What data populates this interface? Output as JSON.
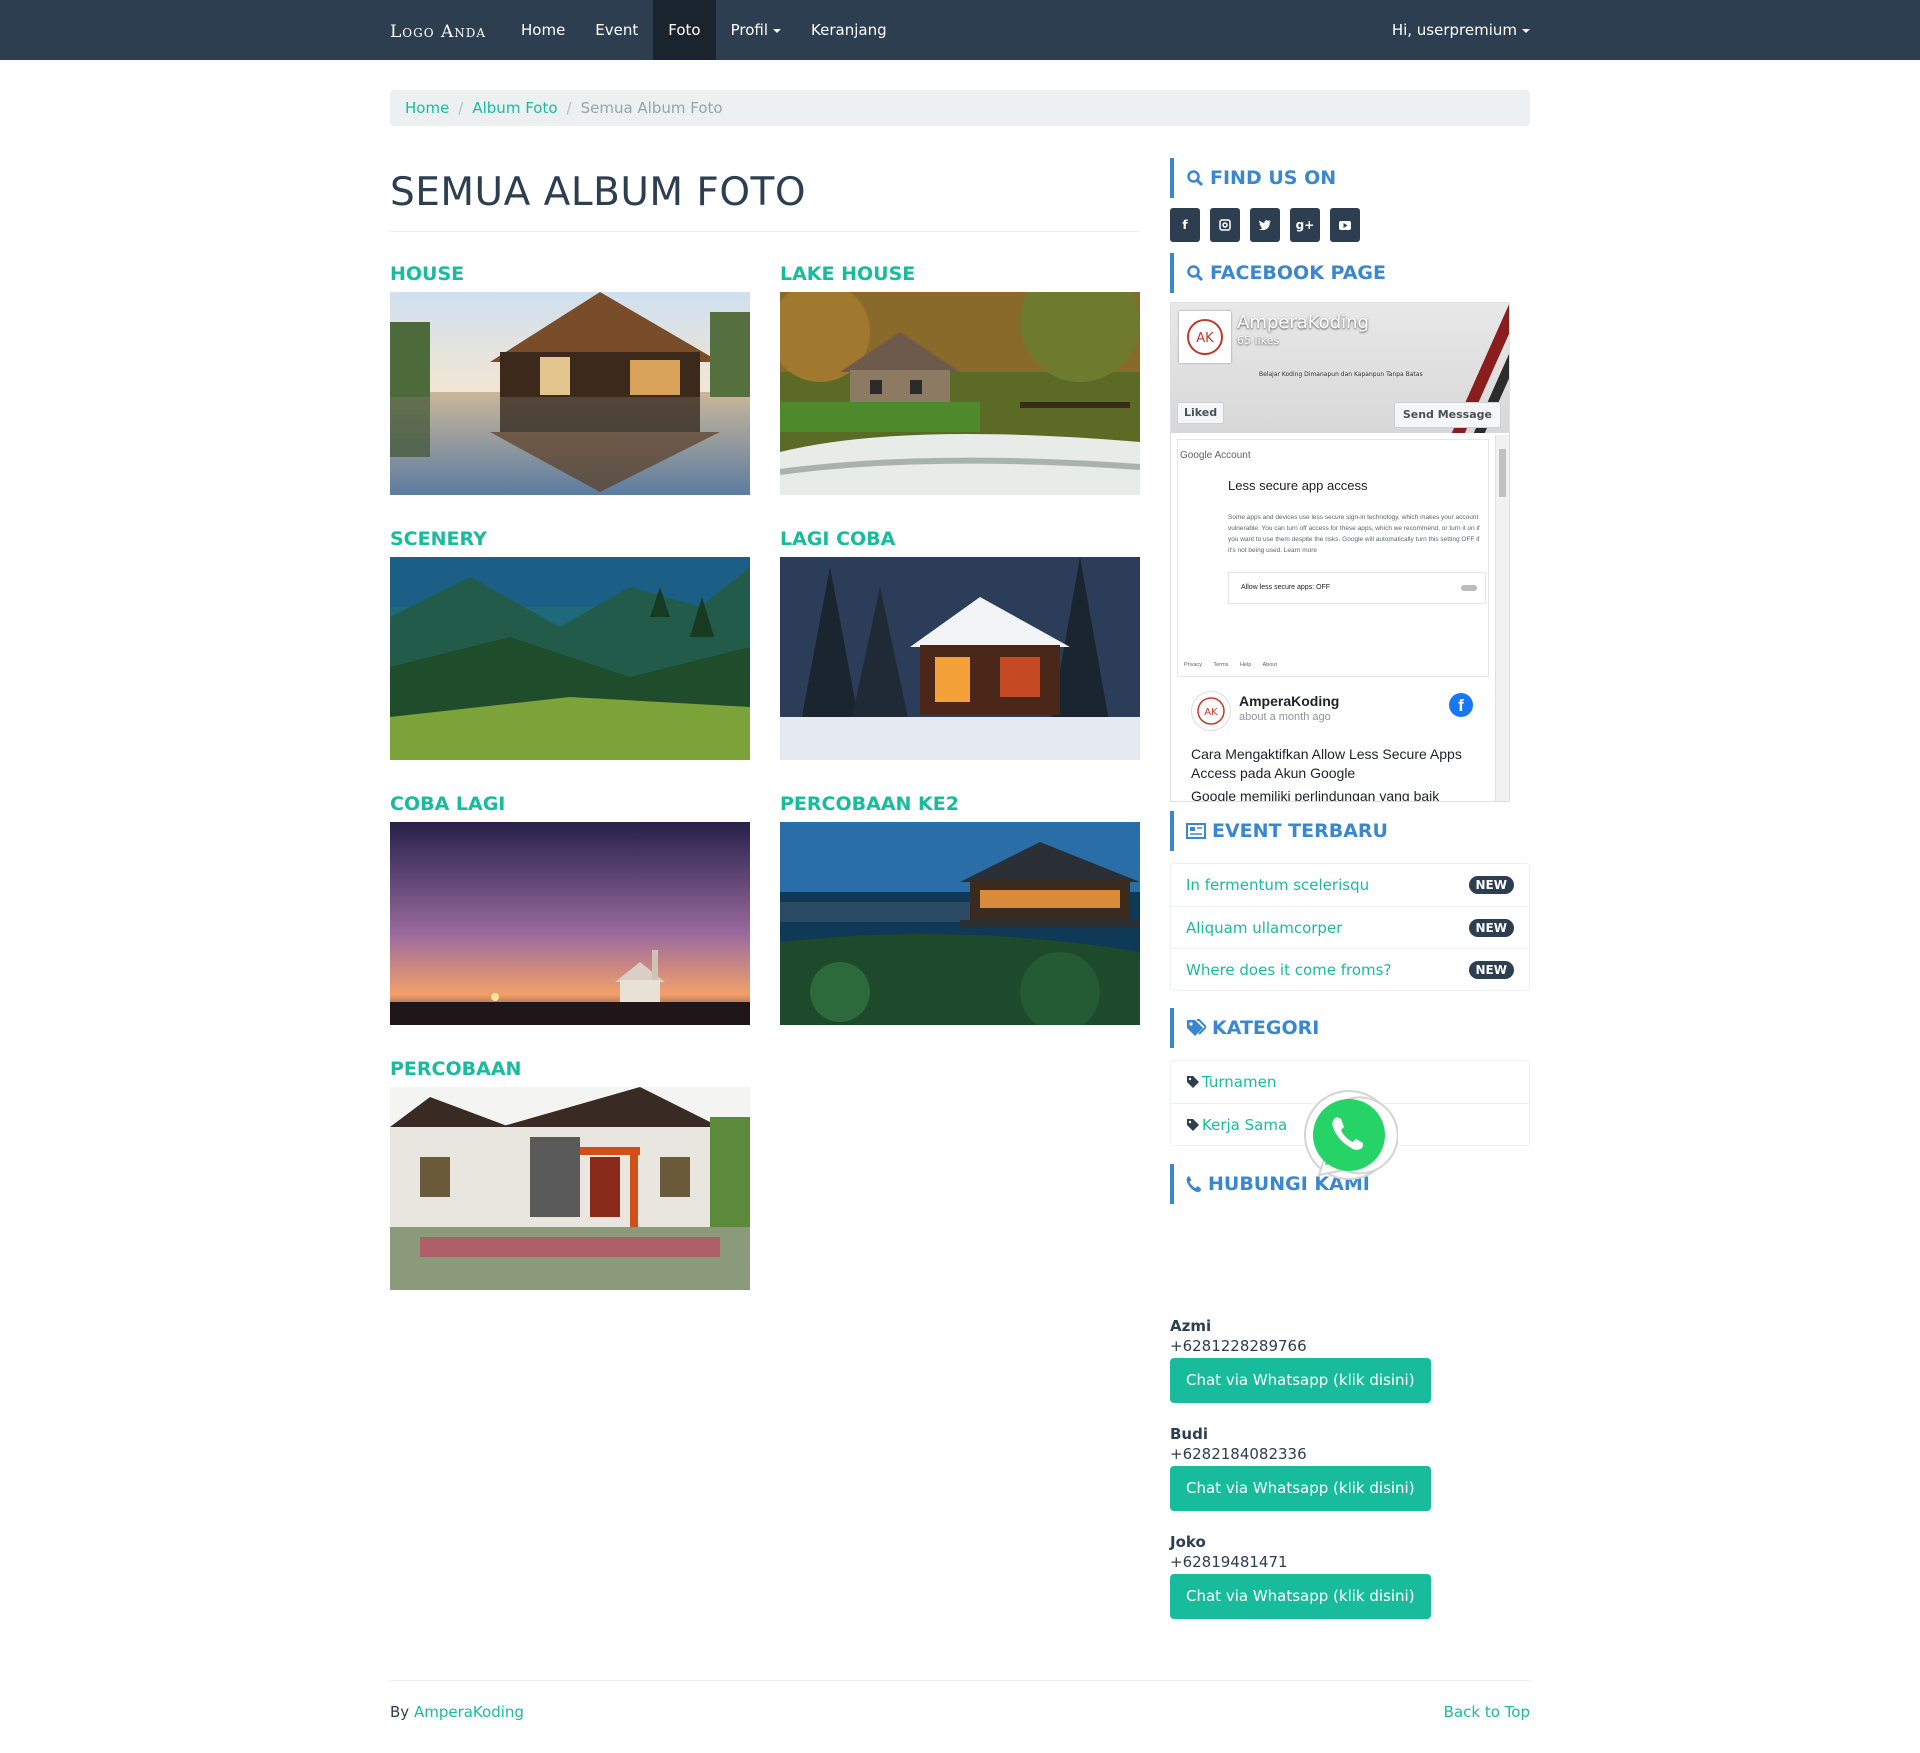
{
  "navbar": {
    "brand": "Logo Anda",
    "links": [
      {
        "label": "Home",
        "active": false
      },
      {
        "label": "Event",
        "active": false
      },
      {
        "label": "Foto",
        "active": true
      },
      {
        "label": "Profil",
        "active": false,
        "dropdown": true
      },
      {
        "label": "Keranjang",
        "active": false
      }
    ],
    "user_menu": "Hi, userpremium"
  },
  "breadcrumb": {
    "items": [
      "Home",
      "Album Foto"
    ],
    "current": "Semua Album Foto"
  },
  "main": {
    "title": "SEMUA ALBUM FOTO",
    "albums": [
      {
        "name": "HOUSE",
        "image": "modern house reflected in pool"
      },
      {
        "name": "LAKE HOUSE",
        "image": "stone cottage by river in forest"
      },
      {
        "name": "SCENERY",
        "image": "green mountain valley"
      },
      {
        "name": "LAGI COBA",
        "image": "lit cabin in snowy forest"
      },
      {
        "name": "COBA LAGI",
        "image": "purple sunset sky over chapel"
      },
      {
        "name": "PERCOBAAN KE2",
        "image": "temple on hill at dusk"
      },
      {
        "name": "PERCOBAAN",
        "image": "residential house rendering"
      }
    ]
  },
  "sidebar": {
    "find_us": {
      "title": "FIND US ON",
      "icons": [
        "facebook-icon",
        "instagram-icon",
        "twitter-icon",
        "google-plus-icon",
        "youtube-icon"
      ]
    },
    "facebook": {
      "title": "FACEBOOK PAGE",
      "page_name": "AmperaKoding",
      "likes": "65 likes",
      "tagline": "Belajar Koding Dimanapun dan Kapanpun Tanpa Batas",
      "liked_label": "Liked",
      "send_label": "Send Message",
      "screenshot": {
        "brand": "Google Account",
        "title": "Less secure app access",
        "body": "Some apps and devices use less secure sign-in technology, which makes your account vulnerable. You can turn off access for these apps, which we recommend, or turn it on if you want to use them despite the risks. Google will automatically turn this setting OFF if it's not being used. Learn more",
        "toggle": "Allow less secure apps: OFF",
        "footer": "Privacy Terms Help About"
      },
      "post_author": "AmperaKoding",
      "post_time": "about a month ago",
      "post_text": "Cara Mengaktifkan Allow Less Secure Apps Access pada Akun Google",
      "post_text_2": "Google memiliki perlindungan yang baik"
    },
    "events": {
      "title": "EVENT TERBARU",
      "items": [
        {
          "label": "In fermentum scelerisqu",
          "badge": "NEW"
        },
        {
          "label": "Aliquam ullamcorper",
          "badge": "NEW"
        },
        {
          "label": "Where does it come froms?",
          "badge": "NEW"
        }
      ]
    },
    "categories": {
      "title": "KATEGORI",
      "items": [
        "Turnamen",
        "Kerja Sama"
      ]
    },
    "contact": {
      "title": "HUBUNGI KAMI",
      "button_label": "Chat via Whatsapp (klik disini)",
      "people": [
        {
          "name": "Azmi",
          "phone": "+6281228289766"
        },
        {
          "name": "Budi",
          "phone": "+6282184082336"
        },
        {
          "name": "Joko",
          "phone": "+62819481471"
        }
      ]
    }
  },
  "footer": {
    "by": "By",
    "author": "AmperaKoding",
    "back_to_top": "Back to Top"
  },
  "colors": {
    "navbar": "#2c3e50",
    "accent": "#18bc9c",
    "widget_title": "#3a87d0",
    "badge": "#2c3e50"
  }
}
